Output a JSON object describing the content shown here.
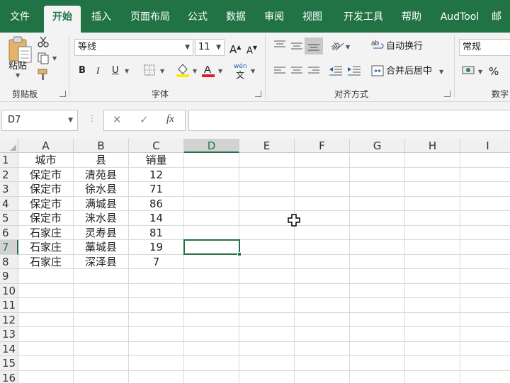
{
  "ribbon_tabs": [
    {
      "label": "文件"
    },
    {
      "label": "开始"
    },
    {
      "label": "插入"
    },
    {
      "label": "页面布局"
    },
    {
      "label": "公式"
    },
    {
      "label": "数据"
    },
    {
      "label": "审阅"
    },
    {
      "label": "视图"
    },
    {
      "label": "开发工具"
    },
    {
      "label": "帮助"
    },
    {
      "label": "AudTool"
    },
    {
      "label": "邮"
    }
  ],
  "active_tab": "开始",
  "clipboard": {
    "paste_label": "粘贴",
    "group_label": "剪贴板"
  },
  "font": {
    "name": "等线",
    "size": "11",
    "group_label": "字体",
    "bold": "B",
    "italic": "I",
    "underline": "U",
    "phonetic": "wén"
  },
  "alignment": {
    "wrap_text_label": "自动换行",
    "merge_center_label": "合并后居中",
    "group_label": "对齐方式"
  },
  "number": {
    "format": "常规",
    "percent": "%",
    "group_label": "数字"
  },
  "formula_bar": {
    "name_box": "D7",
    "fx_label": "fx",
    "formula": ""
  },
  "columns": [
    "A",
    "B",
    "C",
    "D",
    "E",
    "F",
    "G",
    "H",
    "I"
  ],
  "selected_column": "D",
  "rows": [
    "1",
    "2",
    "3",
    "4",
    "5",
    "6",
    "7",
    "8",
    "9",
    "10",
    "11",
    "12",
    "13",
    "14",
    "15",
    "16"
  ],
  "selected_row": "7",
  "table": {
    "headers": [
      "城市",
      "县",
      "销量"
    ],
    "data": [
      [
        "保定市",
        "清苑县",
        "12"
      ],
      [
        "保定市",
        "徐水县",
        "71"
      ],
      [
        "保定市",
        "满城县",
        "86"
      ],
      [
        "保定市",
        "涞水县",
        "14"
      ],
      [
        "石家庄",
        "灵寿县",
        "81"
      ],
      [
        "石家庄",
        "藁城县",
        "19"
      ],
      [
        "石家庄",
        "深泽县",
        "7"
      ]
    ]
  },
  "colors": {
    "accent": "#217346",
    "ribbon_bg": "#f3f3f3"
  }
}
